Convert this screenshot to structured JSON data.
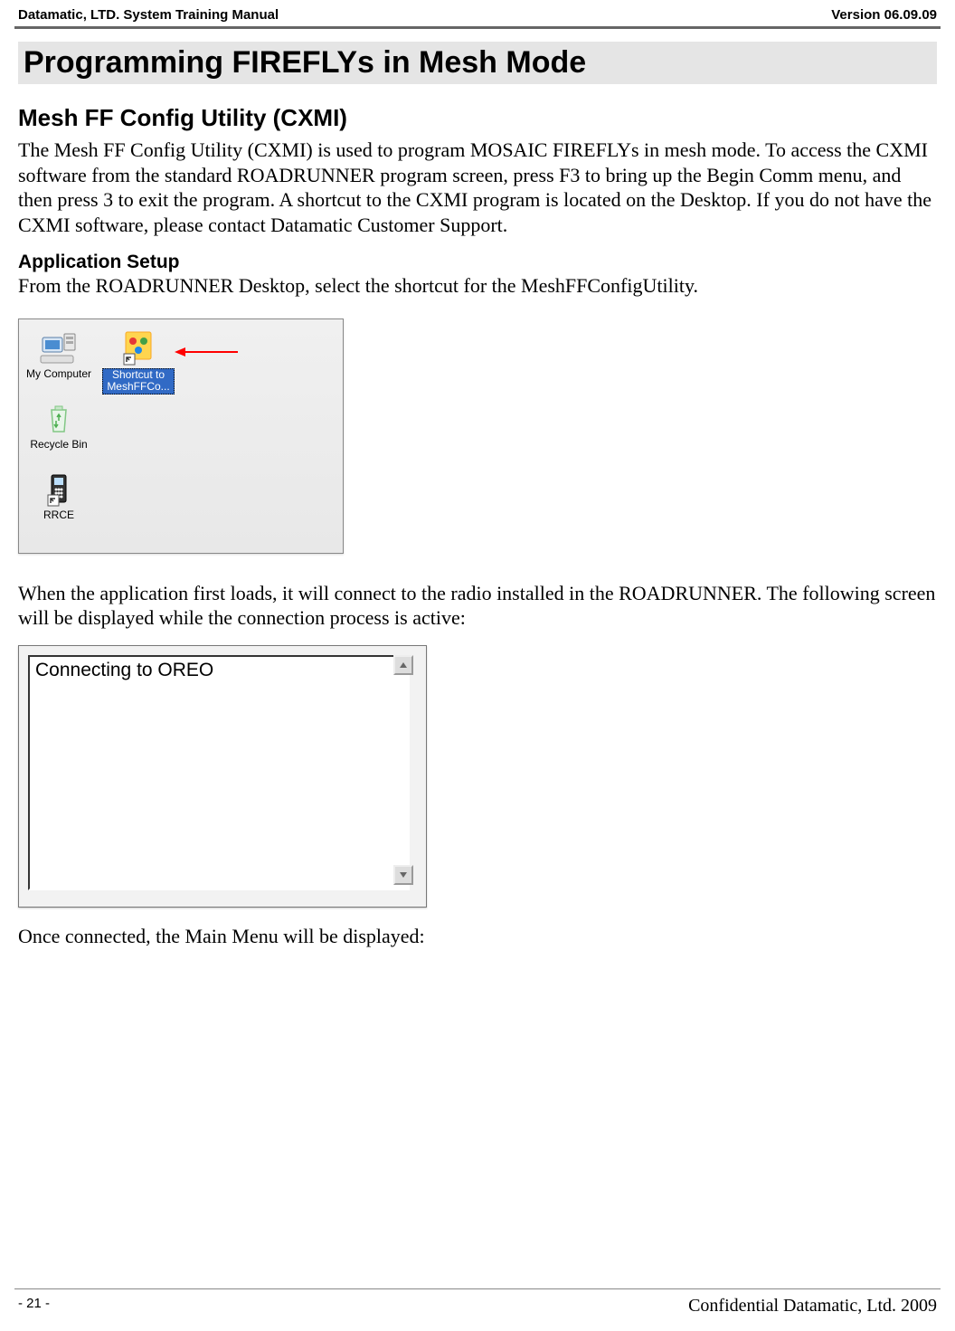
{
  "header": {
    "left": "Datamatic, LTD. System Training  Manual",
    "right": "Version 06.09.09"
  },
  "headings": {
    "main": "Programming FIREFLYs in Mesh Mode",
    "sub": "Mesh FF Config Utility (CXMI)",
    "section": "Application Setup"
  },
  "paragraphs": {
    "intro": "The Mesh FF Config Utility (CXMI) is used to program MOSAIC FIREFLYs in mesh mode.  To access the CXMI software from the standard ROADRUNNER program screen, press F3 to bring up the Begin Comm menu, and then press 3 to exit the program.  A shortcut to the CXMI program is located on the Desktop.  If you do not have the CXMI software, please contact Datamatic Customer Support.",
    "setup": "From the ROADRUNNER Desktop, select the shortcut for the MeshFFConfigUtility.",
    "connecting": "When the application first loads, it will connect to the radio installed in the ROADRUNNER.  The following screen will be displayed while the connection process is active:",
    "connected": "Once connected, the Main Menu will be displayed:"
  },
  "desktop_icons": {
    "my_computer": "My Computer",
    "recycle_bin": "Recycle Bin",
    "rrce": "RRCE",
    "shortcut": "Shortcut to MeshFFCo..."
  },
  "connecting_screen": {
    "text": "Connecting to OREO"
  },
  "footer": {
    "page": "- 21 -",
    "confidential": "Confidential Datamatic, Ltd. 2009"
  }
}
